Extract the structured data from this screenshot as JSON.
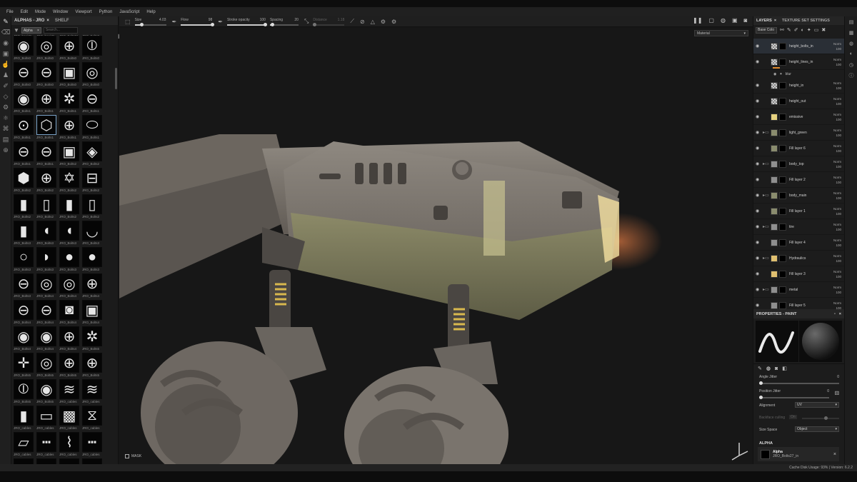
{
  "menu": [
    "File",
    "Edit",
    "Mode",
    "Window",
    "Viewport",
    "Python",
    "JavaScript",
    "Help"
  ],
  "shelf": {
    "tab_active": "ALPHAS - JRO",
    "tab_close": "×",
    "tab_other": "SHELF",
    "filter_chip": "Alpha",
    "filter_chip_close": "×",
    "search_placeholder": "Search...",
    "grid_icon": "grid-view-icon",
    "top_captions": [
      "JRO_basicB",
      "JRO_basicB",
      "JRO_Bolts01",
      "JRO_Bolts0"
    ],
    "items": [
      [
        "JRO_Bolts0",
        "JRO_Bolts0",
        "JRO_Bolts0",
        "JRO_Bolts0"
      ],
      [
        "JRO_Bolts0",
        "JRO_Bolts0",
        "JRO_Bolts0",
        "JRO_Bolts0"
      ],
      [
        "JRO_Bolts1",
        "JRO_Bolts1",
        "JRO_Bolts1",
        "JRO_Bolts1"
      ],
      [
        "JRO_Bolts1",
        "JRO_Bolts1",
        "JRO_Bolts1",
        "JRO_Bolts1"
      ],
      [
        "JRO_Bolts1",
        "JRO_Bolts1",
        "JRO_Bolts2",
        "JRO_Bolts2"
      ],
      [
        "JRO_Bolts2",
        "JRO_Bolts2",
        "JRO_Bolts2",
        "JRO_Bolts2"
      ],
      [
        "JRO_Bolts2",
        "JRO_Bolts2",
        "JRO_Bolts2",
        "JRO_Bolts2"
      ],
      [
        "JRO_Bolts3",
        "JRO_Bolts3",
        "JRO_Bolts3",
        "JRO_Bolts3"
      ],
      [
        "JRO_Bolts3",
        "JRO_Bolts3",
        "JRO_Bolts3",
        "JRO_Bolts3"
      ],
      [
        "JRO_Bolts3",
        "JRO_Bolts4",
        "JRO_Bolts4",
        "JRO_Bolts4"
      ],
      [
        "JRO_Bolts4",
        "JRO_Bolts4",
        "JRO_Bolts4",
        "JRO_Bolts4"
      ],
      [
        "JRO_Bolts4",
        "JRO_Bolts4",
        "JRO_Bolts4",
        "JRO_Bolts5"
      ],
      [
        "JRO_Bolts5",
        "JRO_Bolts5",
        "JRO_Bolts5",
        "JRO_Bolts5"
      ],
      [
        "JRO_Bolts5",
        "JRO_Bolts5",
        "JRO_cables",
        "JRO_cables"
      ],
      [
        "JRO_cables",
        "JRO_cables",
        "JRO_cables",
        "JRO_cables"
      ],
      [
        "JRO_cables",
        "JRO_cables",
        "JRO_cables",
        "JRO_cables"
      ],
      [
        "",
        "",
        "",
        ""
      ]
    ]
  },
  "toolbar": {
    "size_label": "Size",
    "size_value": "4.03",
    "flow_label": "Flow",
    "flow_value": "98",
    "opacity_label": "Stroke opacity",
    "opacity_value": "100",
    "spacing_label": "Spacing",
    "spacing_value": "20",
    "distance_label": "Distance",
    "distance_value": "1.18"
  },
  "viewport": {
    "material_select": "Material",
    "mask_label": "MASK"
  },
  "layers": {
    "tab_active": "LAYERS",
    "tab_close": "×",
    "tab_other": "TEXTURE SET SETTINGS",
    "channel": "Base Colo",
    "list": [
      {
        "name": "height_bolts_in",
        "blend": "Norm",
        "opacity": "100",
        "thumb": "checker",
        "folder": false
      },
      {
        "name": "height_lines_in",
        "blend": "Norm",
        "opacity": "100",
        "thumb": "checker",
        "folder": false
      },
      {
        "name": "height_in",
        "blend": "Norm",
        "opacity": "100",
        "thumb": "checker",
        "folder": false
      },
      {
        "name": "height_out",
        "blend": "Norm",
        "opacity": "100",
        "thumb": "checker",
        "folder": false
      },
      {
        "name": "emissive",
        "blend": "Norm",
        "opacity": "100",
        "thumb": "#e6d280",
        "folder": false
      },
      {
        "name": "light_green",
        "blend": "Norm",
        "opacity": "100",
        "thumb": "#8a8c6e",
        "folder": true
      },
      {
        "name": "Fill layer 6",
        "blend": "Norm",
        "opacity": "100",
        "thumb": "#8a8c6e",
        "folder": false
      },
      {
        "name": "body_top",
        "blend": "Norm",
        "opacity": "100",
        "thumb": "#8f8f8f",
        "folder": true
      },
      {
        "name": "Fill layer 2",
        "blend": "Norm",
        "opacity": "100",
        "thumb": "#8f8f8f",
        "folder": false
      },
      {
        "name": "body_main",
        "blend": "Norm",
        "opacity": "100",
        "thumb": "#8a8c6e",
        "folder": true
      },
      {
        "name": "Fill layer 1",
        "blend": "Norm",
        "opacity": "100",
        "thumb": "#8a8c6e",
        "folder": false
      },
      {
        "name": "tire",
        "blend": "Norm",
        "opacity": "100",
        "thumb": "#8f8f8f",
        "folder": true
      },
      {
        "name": "Fill layer 4",
        "blend": "Norm",
        "opacity": "100",
        "thumb": "#8f8f8f",
        "folder": false
      },
      {
        "name": "Hydraulics",
        "blend": "Norm",
        "opacity": "100",
        "thumb": "#e0c070",
        "folder": true
      },
      {
        "name": "Fill layer 3",
        "blend": "Norm",
        "opacity": "100",
        "thumb": "#e0c070",
        "folder": false
      },
      {
        "name": "metal",
        "blend": "Norm",
        "opacity": "100",
        "thumb": "#8f8f8f",
        "folder": true
      },
      {
        "name": "Fill layer 5",
        "blend": "Norm",
        "opacity": "100",
        "thumb": "#8f8f8f",
        "folder": false
      }
    ],
    "sub_effect": "blur"
  },
  "properties": {
    "title": "PROPERTIES - PAINT",
    "angle_jitter_label": "Angle Jitter",
    "angle_jitter_value": "0",
    "position_jitter_label": "Position Jitter",
    "position_jitter_value": "0",
    "alignment_label": "Alignment",
    "alignment_value": "UV",
    "backface_label": "Backface culling",
    "backface_value": "On",
    "size_space_label": "Size Space",
    "size_space_value": "Object",
    "alpha_section": "ALPHA",
    "alpha_title": "Alpha",
    "alpha_name": "JRO_Bolts27_in",
    "alpha_close": "×"
  },
  "status": {
    "text": "Cache Disk Usage:  93% | Version: 6.2.2"
  },
  "colors": {
    "accent_selected": "#7aa3c8",
    "layer_selected_bg": "#2a2f36",
    "emissive": "#f0d58a"
  }
}
